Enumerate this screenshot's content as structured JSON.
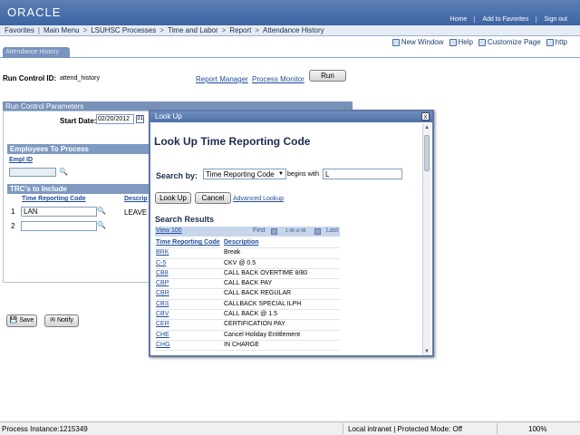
{
  "header": {
    "logo": "ORACLE",
    "links": [
      "Home",
      "Add to Favorites",
      "Sign out"
    ]
  },
  "nav": [
    "Favorites",
    "Main Menu",
    "LSUHSC Processes",
    "Time and Labor",
    "Report",
    "Attendance History"
  ],
  "toolbar": {
    "new_window": "New Window",
    "help": "Help",
    "customize": "Customize Page",
    "http": "http"
  },
  "tab_label": "Attendance History",
  "run_control": {
    "label": "Run Control ID:",
    "value": "attend_history",
    "report_manager": "Report Manager",
    "process_monitor": "Process Monitor",
    "run_button": "Run"
  },
  "params": {
    "section_title": "Run Control Parameters",
    "start_date_label": "Start Date:",
    "start_date_value": "02/20/2012"
  },
  "employees": {
    "title": "Employees To Process",
    "col_empl": "Empl ID"
  },
  "trcs": {
    "title": "TRC's to Include",
    "col_trc": "Time Reporting Code",
    "col_desc": "Descrip",
    "rows": [
      {
        "num": "1",
        "value": "LAN"
      },
      {
        "num": "2",
        "value": ""
      }
    ],
    "leave_text": "LEAVE -"
  },
  "buttons": {
    "save": "Save",
    "notify": "Notify"
  },
  "modal": {
    "title": "Look Up",
    "close": "x",
    "heading": "Look Up Time Reporting Code",
    "search_by_label": "Search by:",
    "search_by_value": "Time Reporting Code",
    "operator": "begins with",
    "search_value": "L",
    "lookup_button": "Look Up",
    "cancel_button": "Cancel",
    "advanced": "Advanced Lookup",
    "results_title": "Search Results",
    "view": "View 100",
    "first": "First",
    "count": "1-98 of 98",
    "last": "Last",
    "col_code": "Time Reporting Code",
    "col_desc": "Description",
    "results": [
      {
        "code": "BRK",
        "desc": "Break"
      },
      {
        "code": "C-5",
        "desc": "CKV @ 0.5"
      },
      {
        "code": "CB8",
        "desc": "CALL BACK OVERTIME 8/80"
      },
      {
        "code": "CBP",
        "desc": "CALL BACK PAY"
      },
      {
        "code": "CBR",
        "desc": "CALL BACK REGULAR"
      },
      {
        "code": "CBS",
        "desc": "CALLBACK SPECIAL ILPH"
      },
      {
        "code": "CBV",
        "desc": "CALL BACK @ 1.5"
      },
      {
        "code": "CER",
        "desc": "CERTIFICATION PAY"
      },
      {
        "code": "CHE",
        "desc": "Cancel Holiday Entitlement"
      },
      {
        "code": "CHG",
        "desc": "IN CHARGE"
      }
    ]
  },
  "status": {
    "process": "Process Instance:1215349",
    "zone": "Local intranet | Protected Mode: Off",
    "zoom": "100%"
  }
}
